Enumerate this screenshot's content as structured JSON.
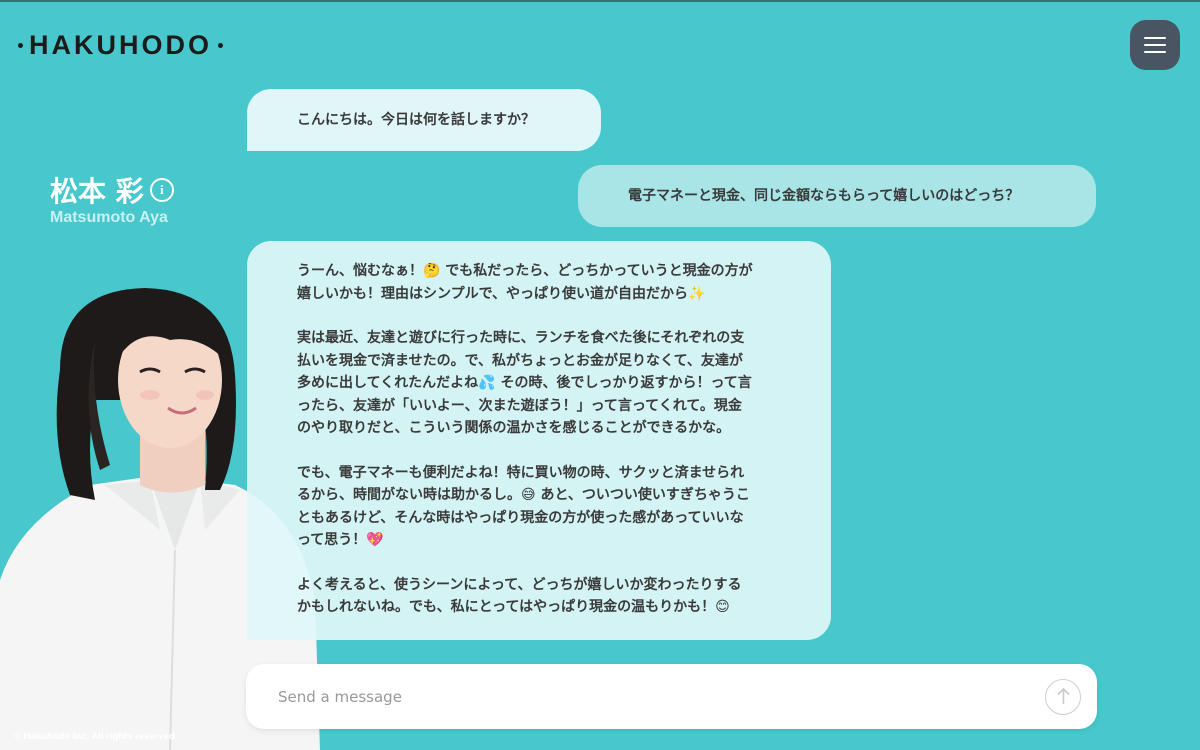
{
  "brand": {
    "logo_text": "HAKUHODO"
  },
  "header": {
    "menu_icon": "hamburger-menu-icon"
  },
  "profile": {
    "name_ja": "松本 彩",
    "name_en": "Matsumoto Aya",
    "info_icon_glyph": "i"
  },
  "messages": [
    {
      "role": "assistant",
      "text": "こんにちは。今日は何を話しますか？"
    },
    {
      "role": "user",
      "text": "電子マネーと現金、同じ金額ならもらって嬉しいのはどっち？"
    },
    {
      "role": "assistant",
      "paragraphs": [
        "うーん、悩むなぁ！🤔 でも私だったら、どっちかっていうと現金の方が\n嬉しいかも！理由はシンプルで、やっぱり使い道が自由だから✨",
        "実は最近、友達と遊びに行った時に、ランチを食べた後にそれぞれの支\n払いを現金で済ませたの。で、私がちょっとお金が足りなくて、友達が\n多めに出してくれたんだよね💦 その時、後でしっかり返すから！って言\nったら、友達が「いいよー、次また遊ぼう！」って言ってくれて。現金\nのやり取りだと、こういう関係の温かさを感じることができるかな。",
        "でも、電子マネーも便利だよね！特に買い物の時、サクッと済ませられ\nるから、時間がない時は助かるし。😅 あと、ついつい使いすぎちゃうこ\nともあるけど、そんな時はやっぱり現金の方が使った感があっていいな\nって思う！💖",
        "よく考えると、使うシーンによって、どっちが嬉しいか変わったりする\nかもしれないね。でも、私にとってはやっぱり現金の温もりかも！😊"
      ]
    }
  ],
  "composer": {
    "placeholder": "Send a message",
    "send_icon": "arrow-up-icon"
  },
  "footer": {
    "copyright": "© Hakuhodo Inc. All rights reserved."
  },
  "colors": {
    "background": "#48c8cc",
    "assistant_bubble": "#e0f6f8",
    "user_bubble": "#a9e4e7",
    "menu_button": "#4a5563"
  }
}
